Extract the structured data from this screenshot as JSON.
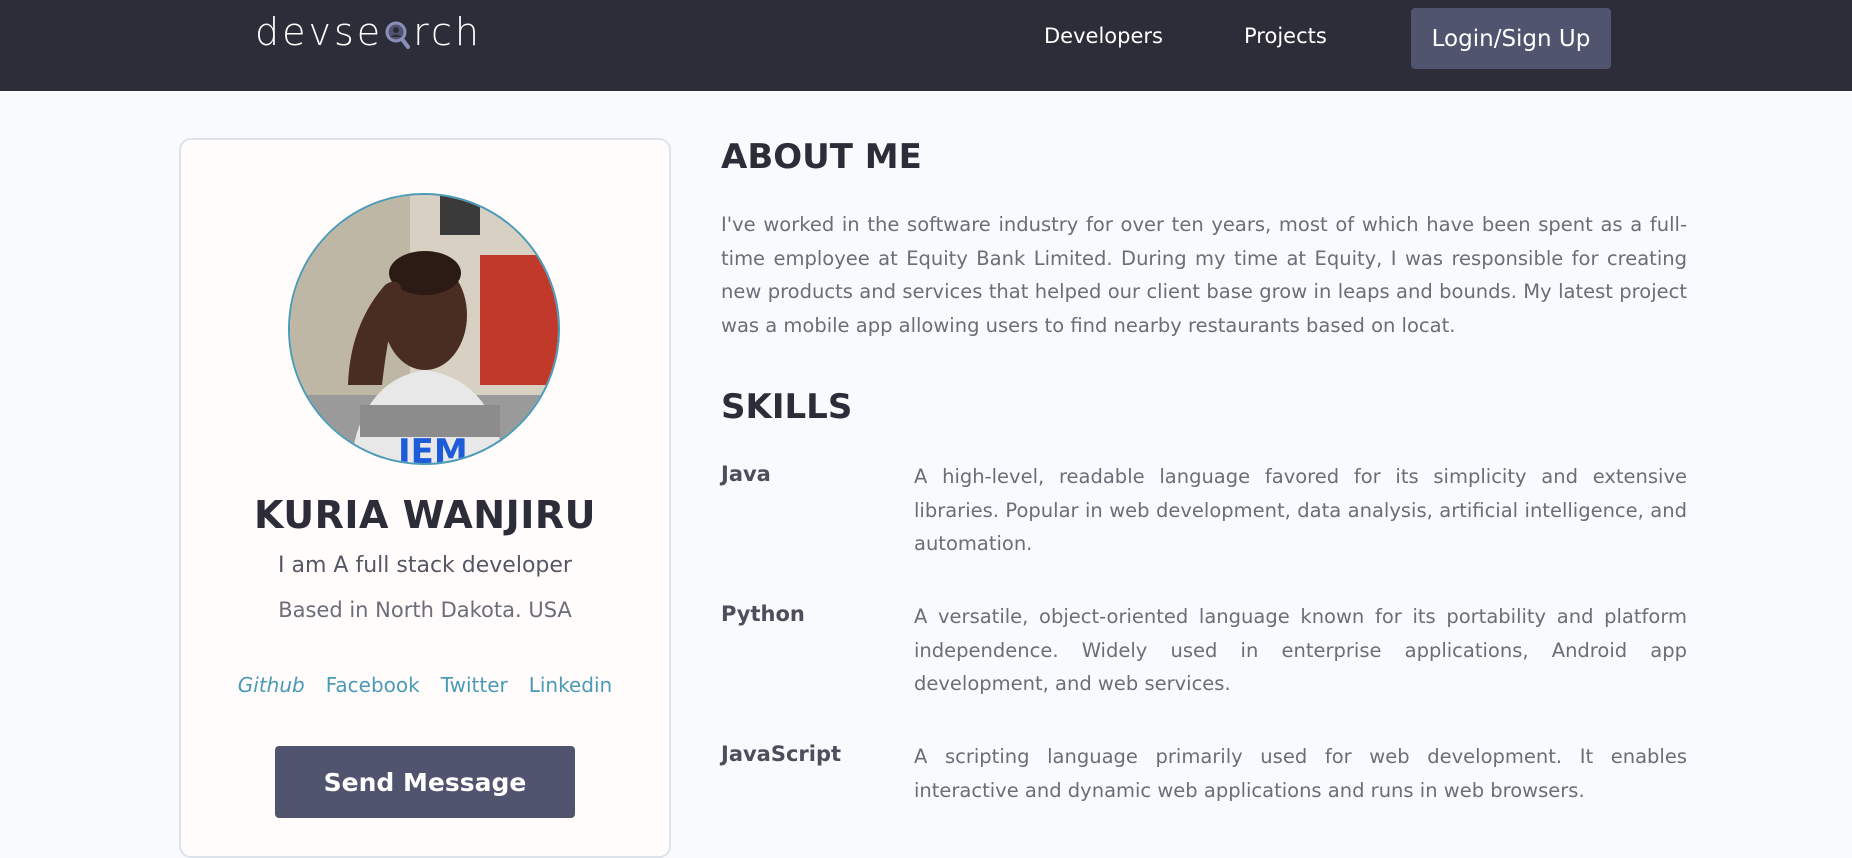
{
  "header": {
    "logo_left": "devse",
    "logo_right": "rch",
    "nav": [
      "Developers",
      "Projects"
    ],
    "login_label": "Login/Sign Up"
  },
  "profile": {
    "name": "KURIA WANJIRU",
    "tagline": "I am A full stack developer",
    "location": "Based in North Dakota. USA",
    "socials": [
      "Github",
      "Facebook",
      "Twitter",
      "Linkedin"
    ],
    "send_label": "Send Message"
  },
  "about": {
    "heading": "ABOUT ME",
    "text": "I've worked in the software industry for over ten years, most of which have been spent as a full-time employee at Equity Bank Limited. During my time at Equity, I was responsible for creating new products and services that helped our client base grow in leaps and bounds. My latest project was a mobile app allowing users to find nearby restaurants based on locat."
  },
  "skills": {
    "heading": "SKILLS",
    "items": [
      {
        "name": "Java",
        "description": "A high-level, readable language favored for its simplicity and extensive libraries. Popular in web development, data analysis, artificial intelligence, and automation."
      },
      {
        "name": "Python",
        "description": "A versatile, object-oriented language known for its portability and platform independence. Widely used in enterprise applications, Android app development, and web services."
      },
      {
        "name": "JavaScript",
        "description": "A scripting language primarily used for web development. It enables interactive and dynamic web applications and runs in web browsers."
      }
    ]
  },
  "colors": {
    "navbar": "#2d2d39",
    "accent": "#4a9bb8",
    "button": "#51546e",
    "background": "#f8fafd"
  }
}
